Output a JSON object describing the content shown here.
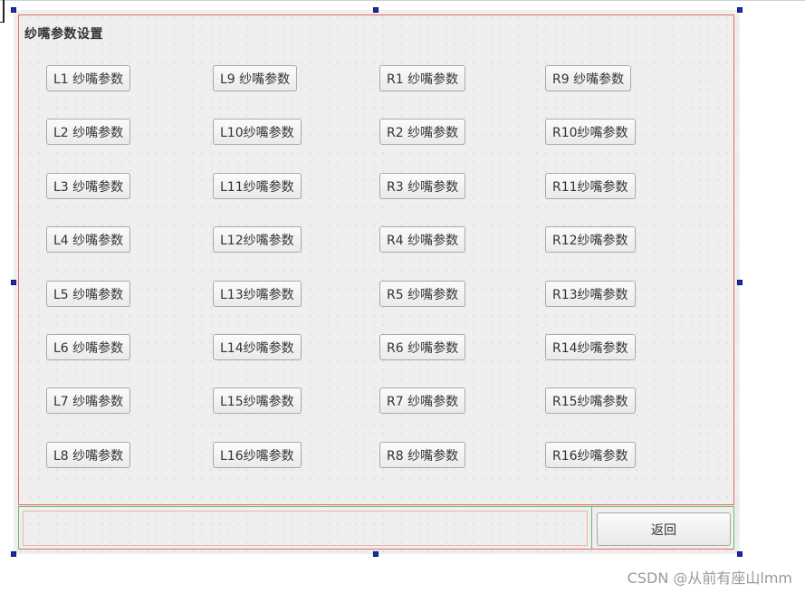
{
  "group": {
    "title": "纱嘴参数设置"
  },
  "buttons": {
    "col1": [
      "L1 纱嘴参数",
      "L2 纱嘴参数",
      "L3 纱嘴参数",
      "L4 纱嘴参数",
      "L5 纱嘴参数",
      "L6 纱嘴参数",
      "L7 纱嘴参数",
      "L8 纱嘴参数"
    ],
    "col2": [
      "L9 纱嘴参数",
      "L10纱嘴参数",
      "L11纱嘴参数",
      "L12纱嘴参数",
      "L13纱嘴参数",
      "L14纱嘴参数",
      "L15纱嘴参数",
      "L16纱嘴参数"
    ],
    "col3": [
      "R1 纱嘴参数",
      "R2 纱嘴参数",
      "R3 纱嘴参数",
      "R4 纱嘴参数",
      "R5 纱嘴参数",
      "R6 纱嘴参数",
      "R7 纱嘴参数",
      "R8 纱嘴参数"
    ],
    "col4": [
      "R9 纱嘴参数",
      "R10纱嘴参数",
      "R11纱嘴参数",
      "R12纱嘴参数",
      "R13纱嘴参数",
      "R14纱嘴参数",
      "R15纱嘴参数",
      "R16纱嘴参数"
    ]
  },
  "footer": {
    "back_label": "返回"
  },
  "watermark": "CSDN @从前有座山lmm",
  "colors": {
    "group_border": "#e46a6a",
    "layout_border": "#6bbd6b",
    "selection_handle": "#1c2fa8"
  }
}
